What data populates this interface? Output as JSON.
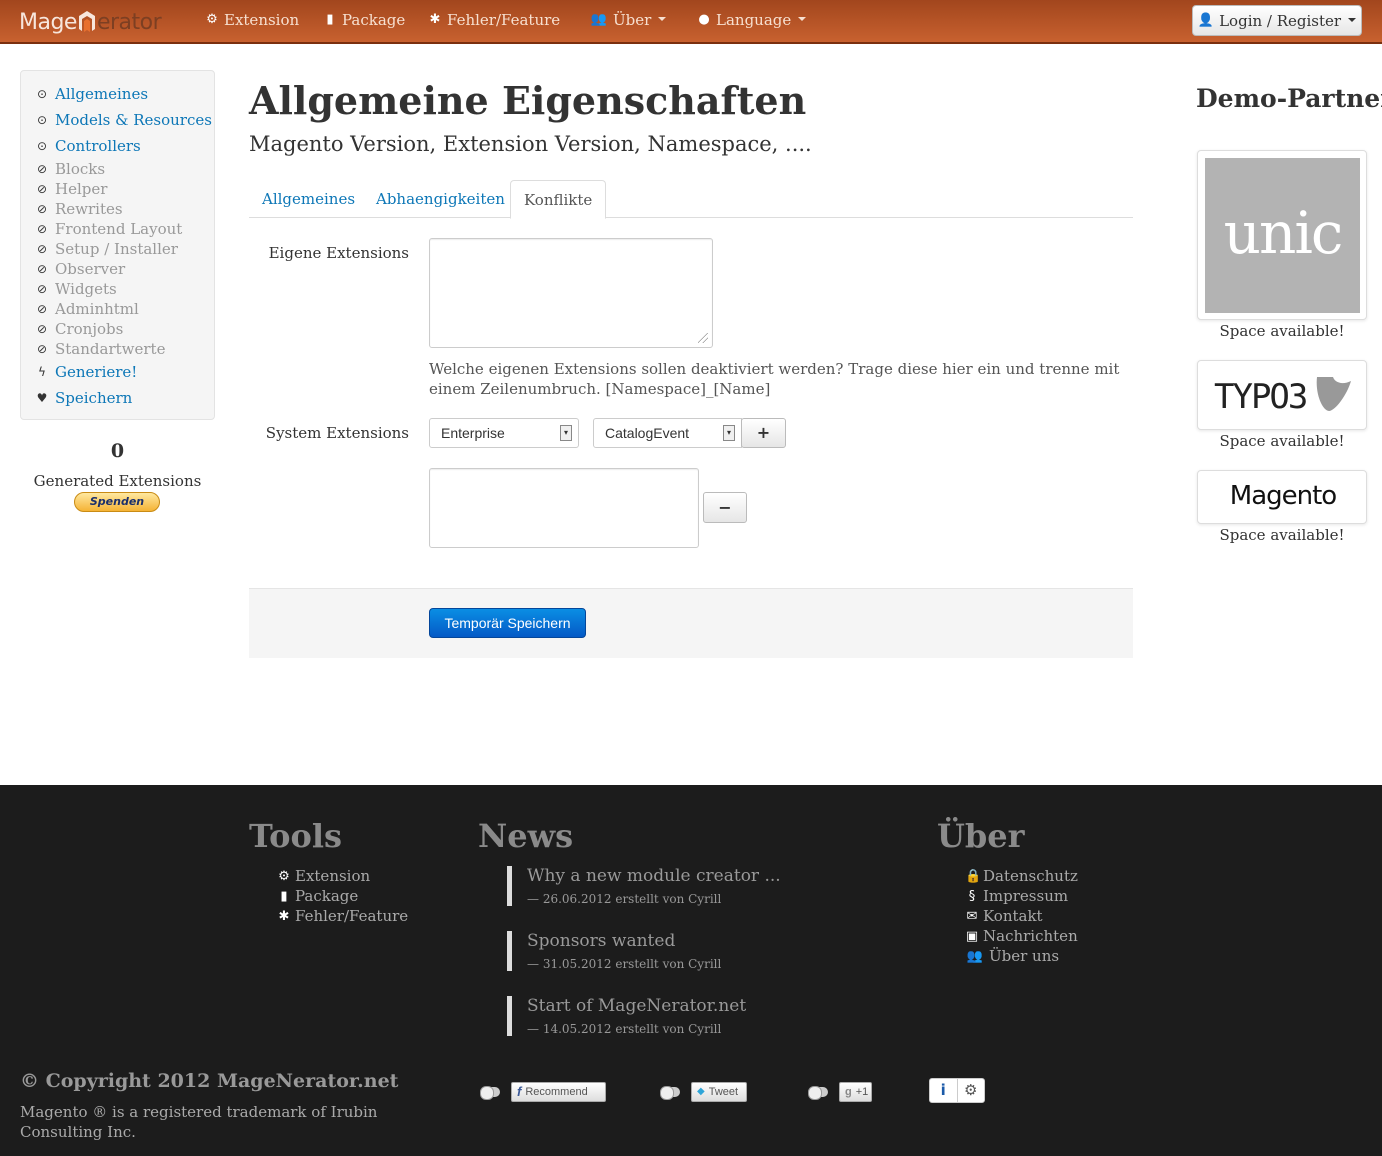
{
  "brand": {
    "part1": "Mage",
    "part2": "erator"
  },
  "nav": {
    "extension": "Extension",
    "package": "Package",
    "fehler": "Fehler/Feature",
    "ueber": "Über",
    "language": "Language",
    "login": "Login / Register"
  },
  "sidebar": {
    "items": [
      {
        "label": "Allgemeines",
        "icon": "check-circle-icon",
        "state": "active"
      },
      {
        "label": "Models & Resources",
        "icon": "check-circle-icon",
        "state": "active"
      },
      {
        "label": "Controllers",
        "icon": "check-circle-icon",
        "state": "active"
      },
      {
        "label": "Blocks",
        "icon": "ban-icon",
        "state": "disabled"
      },
      {
        "label": "Helper",
        "icon": "ban-icon",
        "state": "disabled"
      },
      {
        "label": "Rewrites",
        "icon": "ban-icon",
        "state": "disabled"
      },
      {
        "label": "Frontend Layout",
        "icon": "ban-icon",
        "state": "disabled"
      },
      {
        "label": "Setup / Installer",
        "icon": "ban-icon",
        "state": "disabled"
      },
      {
        "label": "Observer",
        "icon": "ban-icon",
        "state": "disabled"
      },
      {
        "label": "Widgets",
        "icon": "ban-icon",
        "state": "disabled"
      },
      {
        "label": "Adminhtml",
        "icon": "ban-icon",
        "state": "disabled"
      },
      {
        "label": "Cronjobs",
        "icon": "ban-icon",
        "state": "disabled"
      },
      {
        "label": "Standartwerte",
        "icon": "ban-icon",
        "state": "disabled"
      },
      {
        "label": "Generiere!",
        "icon": "bolt-icon",
        "state": "active"
      },
      {
        "label": "Speichern",
        "icon": "heart-icon",
        "state": "active"
      }
    ],
    "count": "0",
    "count_label": "Generated Extensions",
    "donate_label": "Spenden"
  },
  "main": {
    "title": "Allgemeine Eigenschaften",
    "subtitle": "Magento Version, Extension Version, Namespace, ....",
    "tabs": [
      "Allgemeines",
      "Abhaengigkeiten",
      "Konflikte"
    ],
    "active_tab": "Konflikte",
    "own_ext_label": "Eigene Extensions",
    "own_ext_value": "",
    "help_text": "Welche eigenen Extensions sollen deaktiviert werden? Trage diese hier ein und trenne mit einem Zeilenumbruch. [Namespace]_[Name]",
    "sys_ext_label": "System Extensions",
    "select1_value": "Enterprise",
    "select2_value": "CatalogEvent",
    "add_label": "+",
    "remove_label": "−",
    "save_label": "Temporär Speichern"
  },
  "partners": {
    "title": "Demo-Partner",
    "space_label": "Space available!",
    "logos": [
      "unic",
      "TYPO3",
      "Magento"
    ]
  },
  "footer": {
    "tools_title": "Tools",
    "tools": [
      "Extension",
      "Package",
      "Fehler/Feature"
    ],
    "news_title": "News",
    "news": [
      {
        "title": "Why a new module creator ...",
        "meta": "— 26.06.2012 erstellt von Cyrill"
      },
      {
        "title": "Sponsors wanted",
        "meta": "— 31.05.2012 erstellt von Cyrill"
      },
      {
        "title": "Start of MageNerator.net",
        "meta": "— 14.05.2012 erstellt von Cyrill"
      }
    ],
    "about_title": "Über",
    "about": [
      "Datenschutz",
      "Impressum",
      "Kontakt",
      "Nachrichten",
      "Über uns"
    ],
    "copyright": "© Copyright 2012 MageNerator.net",
    "trademark": "Magento ® is a registered trademark of Irubin Consulting Inc.",
    "recommend": "Recommend",
    "tweet": "Tweet",
    "plusone": "+1"
  },
  "colors": {
    "navbar": "#c8612f",
    "link": "#0d77b7",
    "primary": "#0459c6",
    "footer": "#1c1c1c"
  }
}
